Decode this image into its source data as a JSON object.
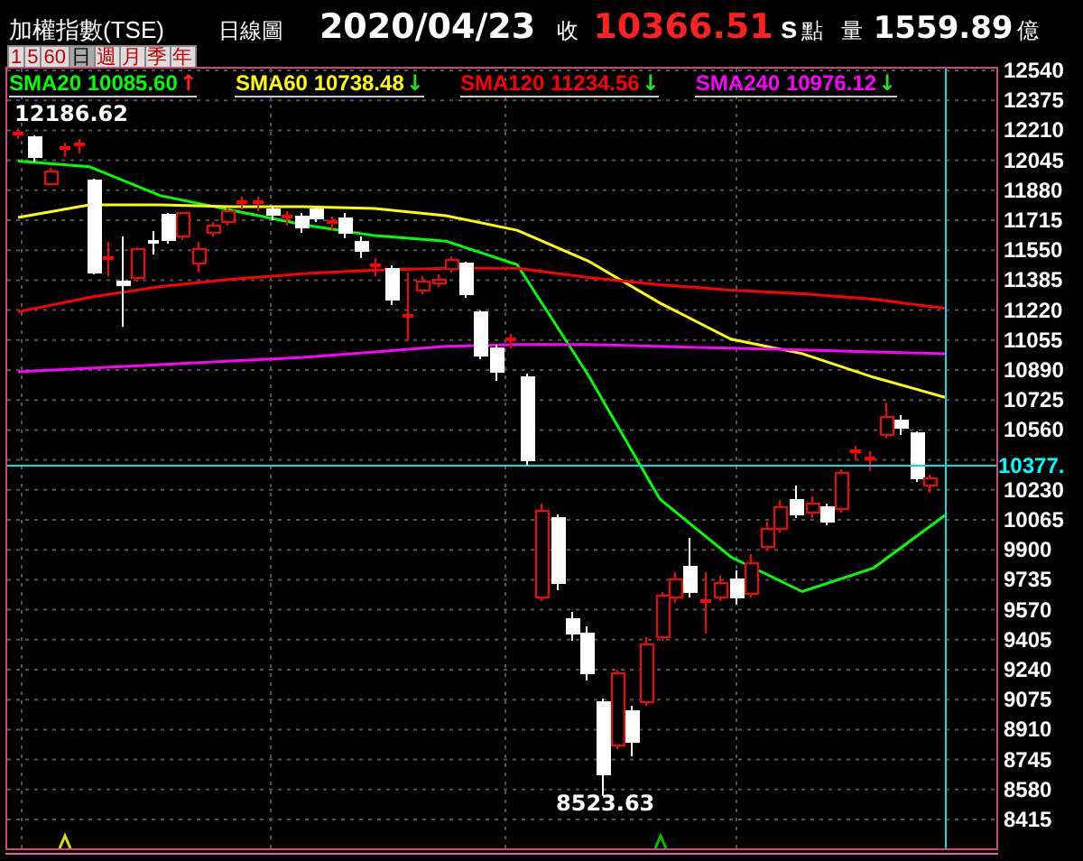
{
  "title": "加權指數(TSE)",
  "chart_kind": "日線圖",
  "date": "2020/04/23",
  "close_label": "收",
  "close": "10366.51",
  "close_suffix": "s",
  "close_unit": "點",
  "volume_label": "量",
  "volume": "1559.89",
  "volume_unit": "億",
  "periods": [
    {
      "label": "1",
      "selected": false
    },
    {
      "label": "5",
      "selected": false
    },
    {
      "label": "60",
      "selected": false
    },
    {
      "label": "日",
      "selected": true
    },
    {
      "label": "週",
      "selected": false
    },
    {
      "label": "月",
      "selected": false
    },
    {
      "label": "季",
      "selected": false
    },
    {
      "label": "年",
      "selected": false
    }
  ],
  "sma": [
    {
      "value": "10085.60",
      "arrow": "↑",
      "rising": true
    },
    {
      "value": "10738.48",
      "arrow": "↓",
      "rising": false
    },
    {
      "value": "11234.56",
      "arrow": "↓",
      "rising": false
    },
    {
      "value": "10976.12",
      "arrow": "↓",
      "rising": false
    }
  ],
  "chart": {
    "current_price": "10377.",
    "high_label": "12186.62",
    "low_label": "8523.63",
    "chart_data": {
      "type": "line",
      "ylim": [
        8250,
        12550
      ],
      "yticks": [
        12540,
        12375,
        12210,
        12045,
        11880,
        11715,
        11550,
        11385,
        11220,
        11055,
        10890,
        10725,
        10560,
        10230,
        10065,
        9900,
        9735,
        9570,
        9405,
        9240,
        9075,
        8910,
        8745,
        8580,
        8415
      ],
      "series": [
        {
          "name": "SMA20",
          "color": "#00ff00",
          "values": [
            12040,
            12010,
            11850,
            11770,
            11690,
            11630,
            11600,
            11470,
            10860,
            10180,
            9860,
            9670,
            9800,
            10090
          ]
        },
        {
          "name": "SMA60",
          "color": "#ffff00",
          "values": [
            11730,
            11800,
            11800,
            11790,
            11790,
            11780,
            11740,
            11660,
            11490,
            11260,
            11060,
            10980,
            10850,
            10740
          ]
        },
        {
          "name": "SMA120",
          "color": "#ff0000",
          "values": [
            11210,
            11290,
            11350,
            11390,
            11420,
            11440,
            11450,
            11450,
            11400,
            11360,
            11330,
            11310,
            11280,
            11230
          ]
        },
        {
          "name": "SMA240",
          "color": "#ff00ff",
          "values": [
            10880,
            10900,
            10920,
            10940,
            10960,
            10990,
            11020,
            11030,
            11030,
            11020,
            11010,
            11000,
            10990,
            10980
          ]
        }
      ]
    }
  }
}
